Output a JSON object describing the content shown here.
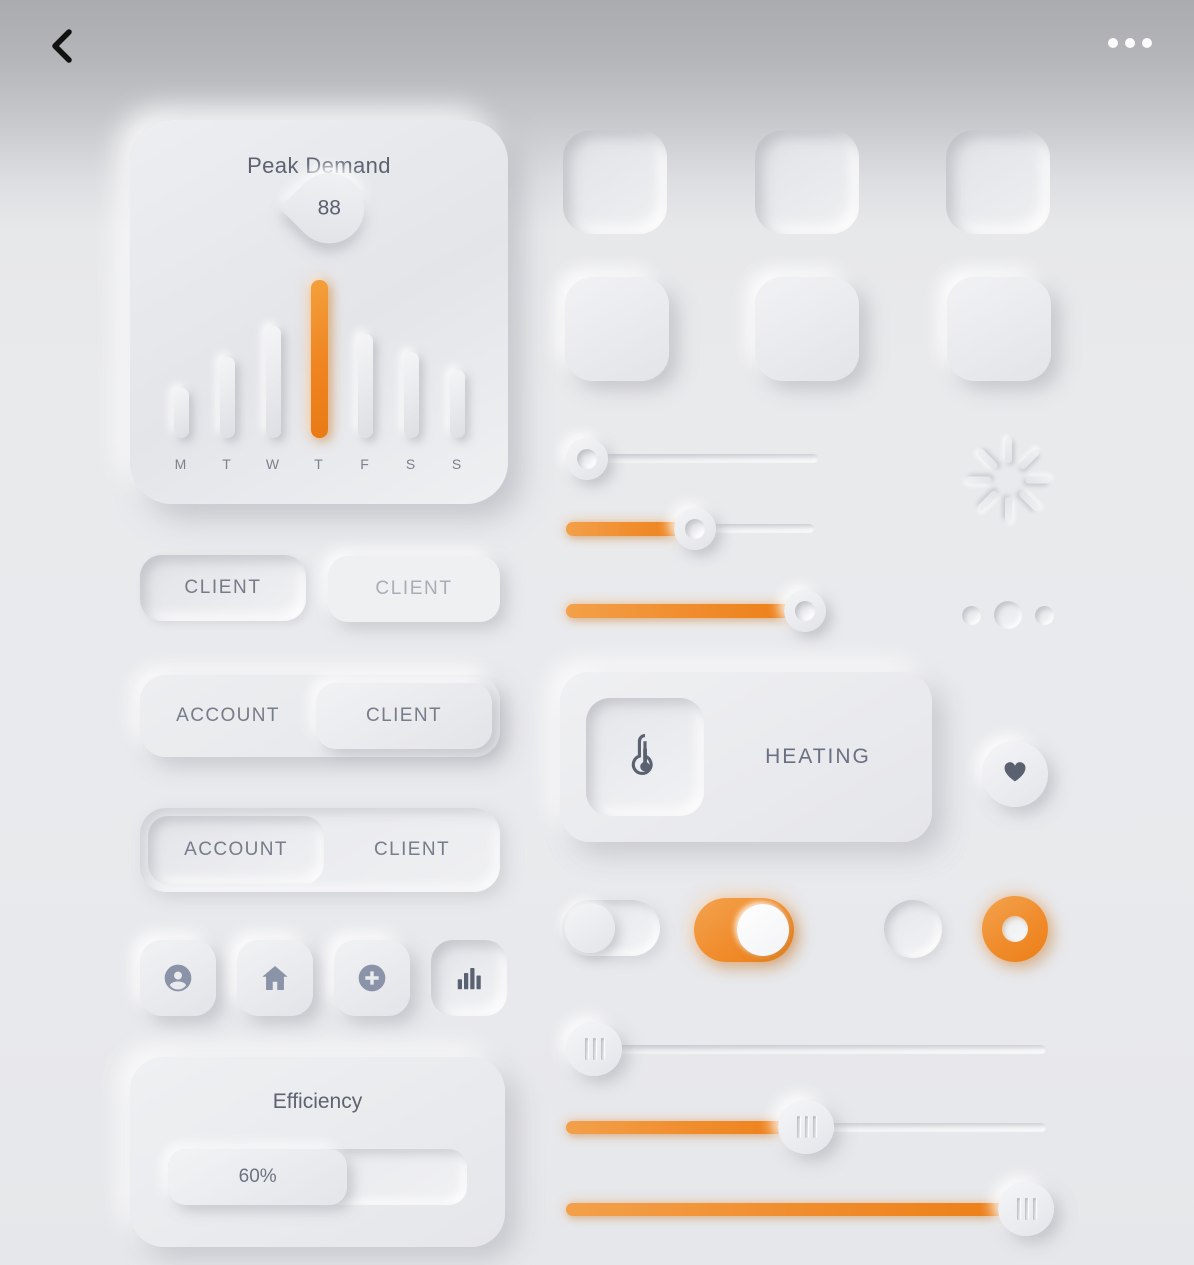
{
  "header": {
    "back_icon": "chevron-left-icon",
    "more_icon": "more-horizontal-icon"
  },
  "peak_demand": {
    "title": "Peak Demand",
    "value_badge": "88"
  },
  "chart_data": {
    "type": "bar",
    "title": "Peak Demand",
    "categories": [
      "M",
      "T",
      "W",
      "T",
      "F",
      "S",
      "S"
    ],
    "values": [
      28,
      45,
      62,
      88,
      58,
      48,
      38
    ],
    "highlight_index": 3,
    "highlight_value": "88",
    "xlabel": "",
    "ylabel": "",
    "ylim": [
      0,
      100
    ],
    "grid": false,
    "legend": "none",
    "accent_color": "#f08c2c",
    "bar_color": "#e8e9ed"
  },
  "buttons": {
    "client_pressed": "CLIENT",
    "client_raised": "CLIENT"
  },
  "segmented_one": {
    "items": [
      {
        "label": "ACCOUNT",
        "selected": false
      },
      {
        "label": "CLIENT",
        "selected": true
      }
    ]
  },
  "segmented_two": {
    "items": [
      {
        "label": "ACCOUNT",
        "selected": true
      },
      {
        "label": "CLIENT",
        "selected": false
      }
    ]
  },
  "icon_buttons": [
    {
      "name": "user-icon",
      "state": "raised"
    },
    {
      "name": "home-icon",
      "state": "raised"
    },
    {
      "name": "plus-circle-icon",
      "state": "raised"
    },
    {
      "name": "bar-chart-icon",
      "state": "pressed"
    }
  ],
  "efficiency": {
    "title": "Efficiency",
    "value_label": "60%",
    "percent": 60
  },
  "square_grid": {
    "rows": [
      {
        "state": "pressed",
        "count": 3
      },
      {
        "state": "raised",
        "count": 3
      }
    ]
  },
  "round_sliders": [
    {
      "percent": 0
    },
    {
      "percent": 48
    },
    {
      "percent": 95
    }
  ],
  "grip_sliders": [
    {
      "percent": 0
    },
    {
      "percent": 45
    },
    {
      "percent": 92
    }
  ],
  "spinner": {
    "icon": "loading-spinner-icon",
    "spokes": 8
  },
  "dots_indicator": {
    "icon": "three-dots-icon",
    "count": 3,
    "active_index": 1
  },
  "heating_card": {
    "label": "HEATING",
    "icon": "thermometer-icon"
  },
  "heart_button": {
    "icon": "heart-icon"
  },
  "toggles": [
    {
      "name": "toggle-off",
      "state": "off"
    },
    {
      "name": "toggle-on",
      "state": "on"
    }
  ],
  "radios": [
    {
      "name": "radio-off",
      "state": "off"
    },
    {
      "name": "radio-on",
      "state": "on"
    }
  ],
  "colors": {
    "accent_orange": "#f08c2c",
    "background_top": "#a9abaf",
    "background_bottom": "#e7e8ea",
    "text_primary": "#5c6270",
    "text_muted": "#a8adb6",
    "icon_blue_gray": "#8b93a8"
  }
}
